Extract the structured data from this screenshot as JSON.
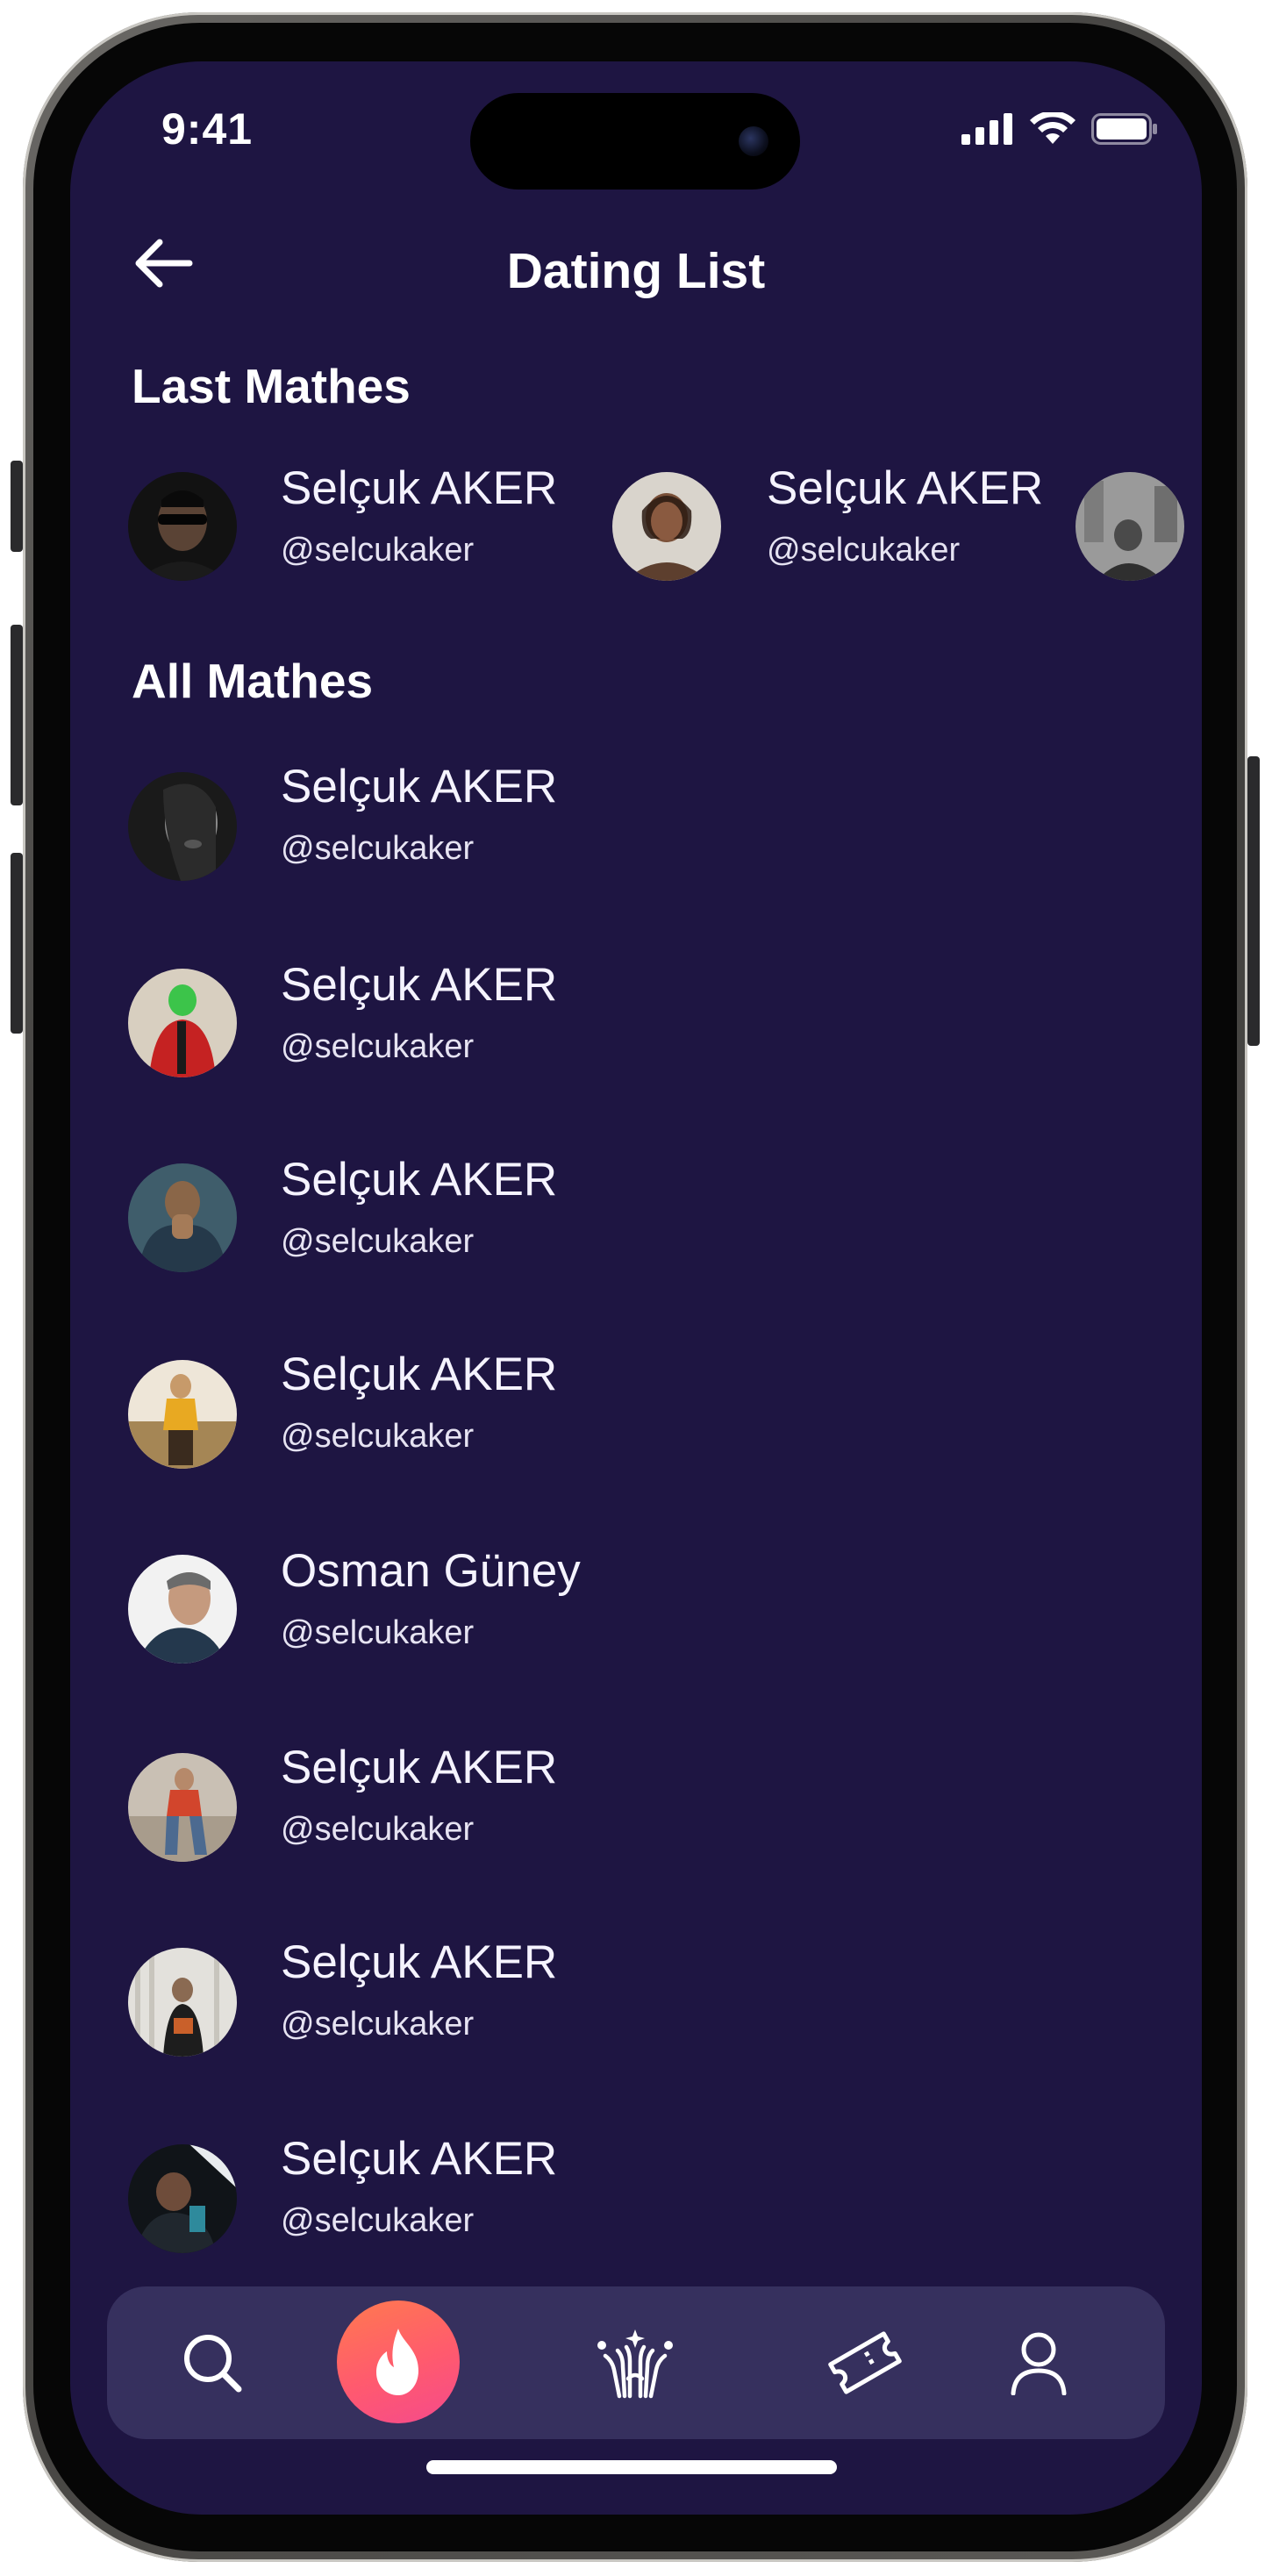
{
  "status_bar": {
    "time": "9:41"
  },
  "header": {
    "title": "Dating List"
  },
  "sections": {
    "last_matches_title": "Last Mathes",
    "all_matches_title": "All Mathes"
  },
  "last_matches": [
    {
      "name": "Selçuk AKER",
      "handle": "@selcukaker"
    },
    {
      "name": "Selçuk AKER",
      "handle": "@selcukaker"
    }
  ],
  "all_matches": [
    {
      "name": "Selçuk AKER",
      "handle": "@selcukaker"
    },
    {
      "name": "Selçuk AKER",
      "handle": "@selcukaker"
    },
    {
      "name": "Selçuk AKER",
      "handle": "@selcukaker"
    },
    {
      "name": "Selçuk AKER",
      "handle": "@selcukaker"
    },
    {
      "name": "Osman Güney",
      "handle": "@selcukaker"
    },
    {
      "name": "Selçuk AKER",
      "handle": "@selcukaker"
    },
    {
      "name": "Selçuk AKER",
      "handle": "@selcukaker"
    },
    {
      "name": "Selçuk AKER",
      "handle": "@selcukaker"
    }
  ],
  "tab_bar": {
    "tabs": [
      "search-icon",
      "flame-icon",
      "hands-icon",
      "ticket-icon",
      "profile-icon"
    ],
    "active": "flame-icon"
  },
  "colors": {
    "background": "#1e1542",
    "tab_bar": "#36305e",
    "accent_gradient_start": "#ff7a4f",
    "accent_gradient_end": "#f54a8c",
    "text": "#ffffff"
  }
}
